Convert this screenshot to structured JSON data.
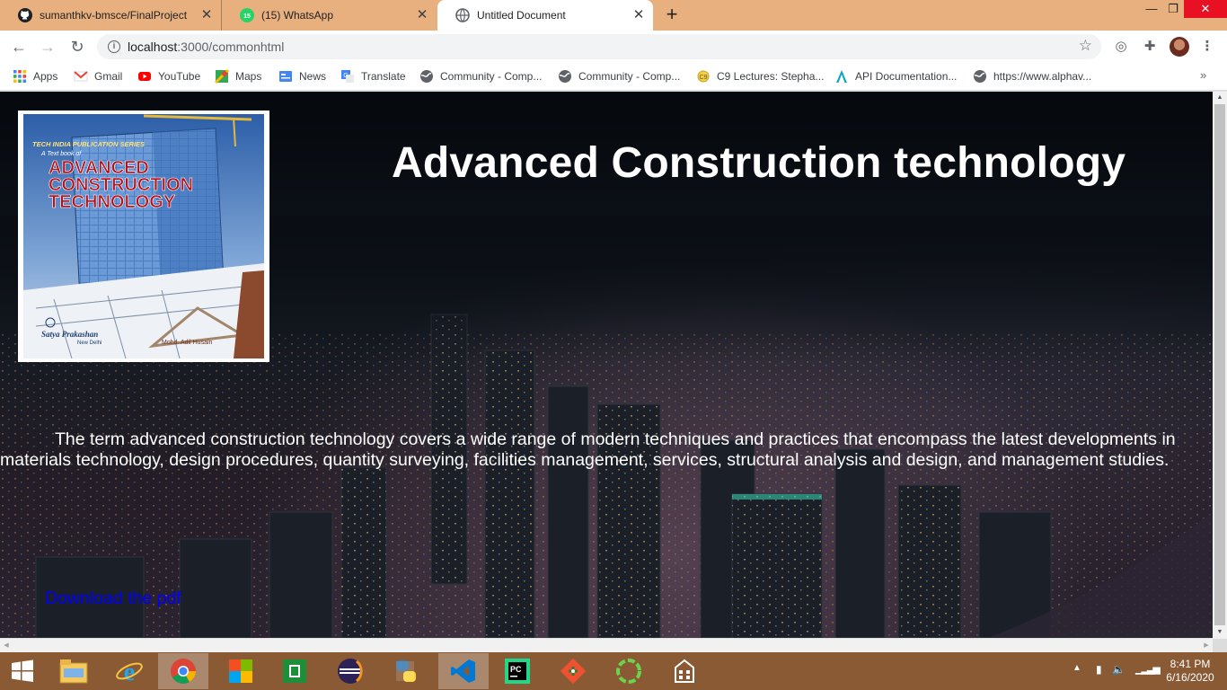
{
  "browser": {
    "tabs": [
      {
        "title": "sumanthkv-bmsce/FinalProject",
        "icon": "github-icon"
      },
      {
        "title": "(15) WhatsApp",
        "icon": "whatsapp-icon",
        "badge": "15"
      },
      {
        "title": "Untitled Document",
        "icon": "globe-icon",
        "active": true
      }
    ],
    "address": {
      "host": "localhost",
      "path": ":3000/commonhtml"
    },
    "bookmarks": [
      {
        "label": "Apps",
        "icon": "apps-grid-icon"
      },
      {
        "label": "Gmail",
        "icon": "gmail-icon"
      },
      {
        "label": "YouTube",
        "icon": "youtube-icon"
      },
      {
        "label": "Maps",
        "icon": "maps-icon"
      },
      {
        "label": "News",
        "icon": "news-icon"
      },
      {
        "label": "Translate",
        "icon": "translate-icon"
      },
      {
        "label": "Community - Comp...",
        "icon": "globe-icon"
      },
      {
        "label": "Community - Comp...",
        "icon": "globe-icon"
      },
      {
        "label": "C9 Lectures: Stepha...",
        "icon": "c9-icon"
      },
      {
        "label": "API Documentation...",
        "icon": "api-icon"
      },
      {
        "label": "https://www.alphav...",
        "icon": "globe-icon"
      }
    ],
    "more_bookmarks": "»"
  },
  "page": {
    "title": "Advanced Construction technology",
    "description": "The term advanced construction technology covers a wide range of modern techniques and practices that encompass the latest developments in materials technology, design procedures, quantity surveying, facilities management, services, structural analysis and design, and management studies.",
    "download_link": "Download the pdf",
    "book_cover": {
      "series": "TECH INDIA PUBLICATION SERIES",
      "subtitle": "A Text book of",
      "line1": "ADVANCED",
      "line2": "CONSTRUCTION",
      "line3": "TECHNOLOGY",
      "publisher": "Satya Prakashan",
      "city": "New Delhi",
      "author": "Mohd. Adil Husain"
    }
  },
  "taskbar": {
    "apps": [
      "file-explorer-icon",
      "internet-explorer-icon",
      "chrome-icon",
      "office-icon",
      "excel-icon",
      "eclipse-icon",
      "python-icon",
      "vscode-icon",
      "pycharm-icon",
      "git-icon",
      "sync-icon",
      "calculator-icon"
    ],
    "time": "8:41 PM",
    "date": "6/16/2020"
  },
  "colors": {
    "tabstrip": "#e8b07e",
    "taskbar": "#8a5a35",
    "link": "#0000ff",
    "close": "#e81123"
  }
}
